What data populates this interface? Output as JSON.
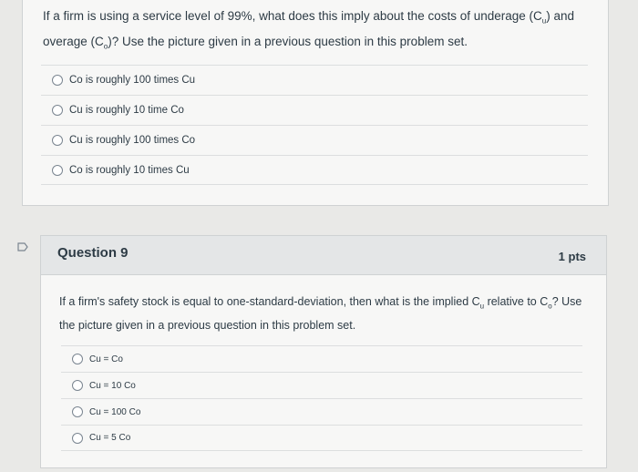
{
  "question8": {
    "text_part1": "If a firm is using a service level of 99%, what does this imply about the costs of underage (C",
    "sub_u": "u",
    "text_part2": ") and overage (C",
    "sub_o": "o",
    "text_part3": ")? Use the picture given in a previous question in this problem set.",
    "answers": [
      "Co is roughly 100 times Cu",
      "Cu is roughly 10 time Co",
      "Cu is roughly 100 times Co",
      "Co is roughly 10 times Cu"
    ]
  },
  "question9": {
    "title": "Question 9",
    "points": "1 pts",
    "text_part1": "If a firm's safety stock is equal to one-standard-deviation, then what is the implied C",
    "sub_u": "u",
    "text_part2": " relative to C",
    "sub_o": "o",
    "text_part3": "? Use the picture given in a previous question in this problem set.",
    "answers": [
      "Cu = Co",
      "Cu = 10 Co",
      "Cu = 100 Co",
      "Cu = 5 Co"
    ]
  }
}
